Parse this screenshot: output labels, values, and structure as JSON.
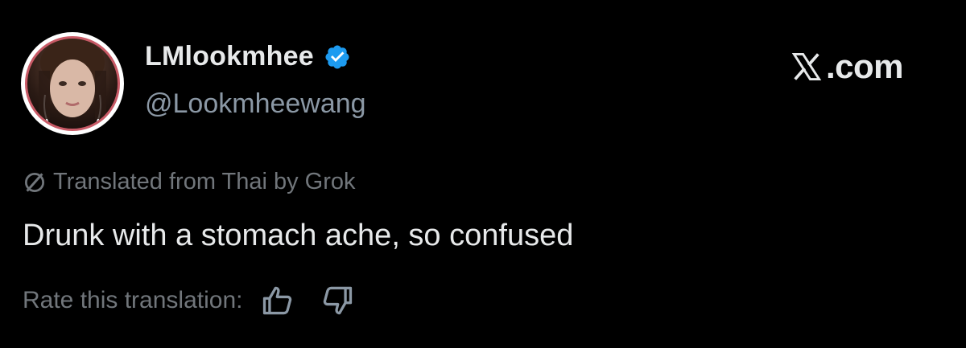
{
  "user": {
    "display_name": "LMlookmhee",
    "handle": "@Lookmheewang",
    "verified_icon": "verified-badge-icon",
    "verified_color": "#1d9bf0"
  },
  "brand": {
    "logo_icon": "x-logo-icon",
    "logo_suffix": ".com"
  },
  "translation": {
    "icon": "grok-icon",
    "notice": "Translated from Thai by Grok"
  },
  "tweet": {
    "text": "Drunk with a stomach ache, so confused"
  },
  "rating": {
    "label": "Rate this translation:",
    "thumbs_up_icon": "thumbs-up-icon",
    "thumbs_down_icon": "thumbs-down-icon"
  },
  "colors": {
    "background": "#000000",
    "primary_text": "#e7e9ea",
    "secondary_text": "#71767b",
    "handle_text": "#8b98a5"
  }
}
